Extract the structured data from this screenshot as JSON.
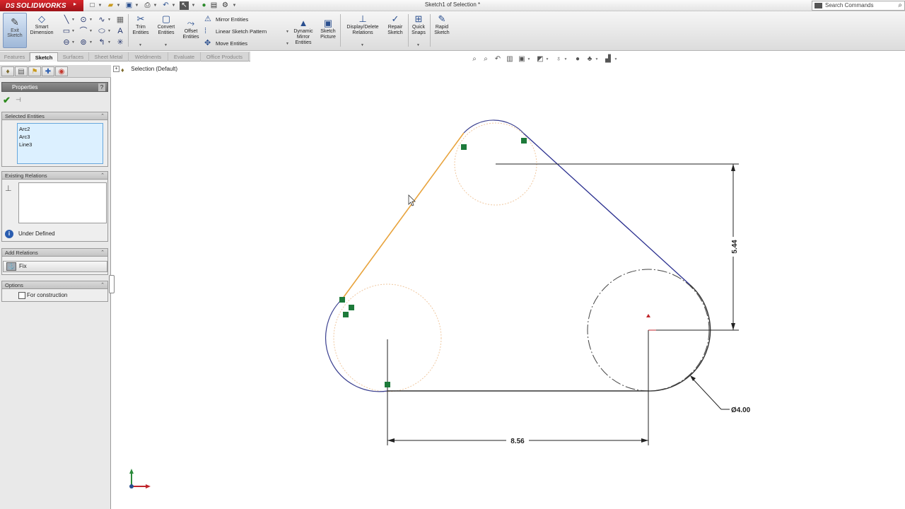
{
  "app": {
    "brand": "SOLIDWORKS",
    "brand_prefix": "DS",
    "document_title": "Sketch1 of Selection *",
    "search_placeholder": "Search Commands"
  },
  "ribbon": {
    "exit_sketch": "Exit Sketch",
    "smart_dimension": "Smart Dimension",
    "trim_entities": "Trim Entities",
    "convert_entities": "Convert Entities",
    "offset_entities": "Offset Entities",
    "mirror_entities": "Mirror Entities",
    "linear_sketch_pattern": "Linear Sketch Pattern",
    "move_entities": "Move Entities",
    "dynamic_mirror_entities": "Dynamic Mirror Entities",
    "sketch_picture": "Sketch Picture",
    "display_delete_relations": "Display/Delete Relations",
    "repair_sketch": "Repair Sketch",
    "quick_snaps": "Quick Snaps",
    "rapid_sketch": "Rapid Sketch"
  },
  "tabs": [
    {
      "label": "Features",
      "active": false
    },
    {
      "label": "Sketch",
      "active": true
    },
    {
      "label": "Surfaces",
      "active": false
    },
    {
      "label": "Sheet Metal",
      "active": false
    },
    {
      "label": "Weldments",
      "active": false
    },
    {
      "label": "Evaluate",
      "active": false
    },
    {
      "label": "Office Products",
      "active": false
    }
  ],
  "panel": {
    "properties_title": "Properties",
    "selected_entities_title": "Selected Entities",
    "selected_entities": [
      "Arc2",
      "Arc3",
      "Line3"
    ],
    "existing_relations_title": "Existing Relations",
    "status": "Under Defined",
    "add_relations_title": "Add Relations",
    "fix_label": "Fix",
    "options_title": "Options",
    "for_construction_label": "For construction"
  },
  "tree": {
    "root_label": "Selection  (Default)"
  },
  "dimensions": {
    "vertical": "5.44",
    "horizontal": "8.56",
    "diameter": "Ø4.00"
  },
  "colors": {
    "brand_red": "#c21f26",
    "sketch_line_selected": "#e8a33c",
    "sketch_line_blue": "#2a2f8f",
    "relation_marker": "#1d7a3a",
    "panel_background": "#e9e9e9",
    "selection_box": "#dcf0ff"
  }
}
